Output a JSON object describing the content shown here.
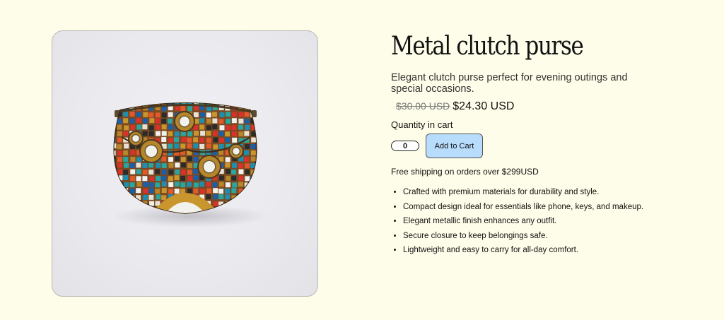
{
  "product": {
    "image_alt": "Metal clutch purse with mosaic design",
    "title": "Metal clutch purse",
    "description": "Elegant clutch purse perfect for evening outings and special occasions.",
    "price_original": "$30.00 USD",
    "price_sale": "$24.30 USD",
    "quantity_label": "Quantity in cart",
    "quantity_value": "0",
    "add_to_cart_label": "Add to Cart",
    "shipping_note": "Free shipping on orders over $299USD",
    "features": [
      "Crafted with premium materials for durability and style.",
      "Compact design ideal for essentials like phone, keys, and makeup.",
      "Elegant metallic finish enhances any outfit.",
      "Secure closure to keep belongings safe.",
      "Lightweight and easy to carry for all-day comfort."
    ]
  },
  "colors": {
    "background": "#fefde9",
    "button": "#b8dcfb"
  }
}
